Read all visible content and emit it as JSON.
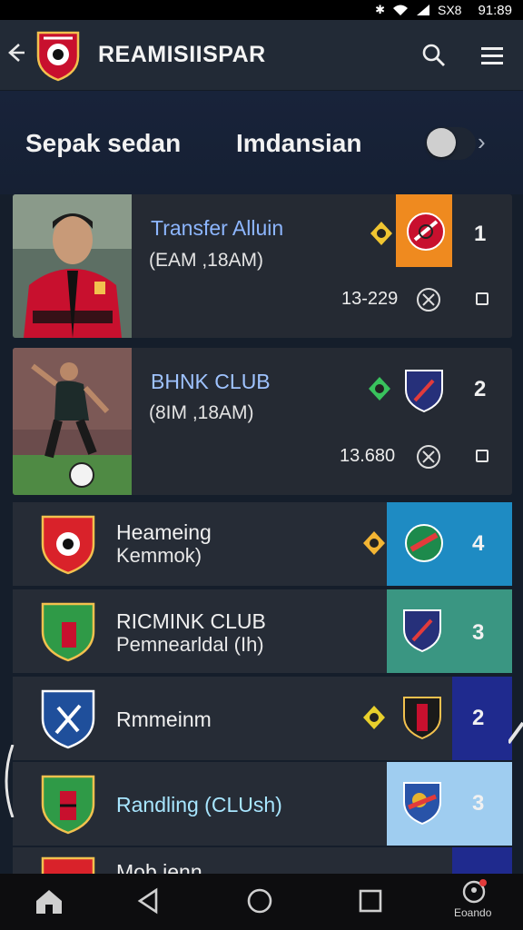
{
  "status": {
    "signal_text": "SX8",
    "time": "91:89"
  },
  "header": {
    "title": "REAMISIISPAR"
  },
  "filters": {
    "left_label": "Sepak sedan",
    "right_label": "Imdansian"
  },
  "cards": [
    {
      "title": "Transfer Alluin",
      "subtitle": "(EAM ,18AM)",
      "number": "13-229",
      "rank": "1",
      "title_color": "#8db6ff",
      "block_color": "#ef8a1f"
    },
    {
      "title": "BHNK CLUB",
      "subtitle": "(8IM ,18AM)",
      "number": "13.680",
      "rank": "2",
      "title_color": "#9fc3ff",
      "block_color": "#252a33"
    }
  ],
  "rows": [
    {
      "line1": "Heameing",
      "line2": "Kemmok)",
      "rank": "4",
      "block_color": "#1e8bc3",
      "name_color": "#f0f0f0"
    },
    {
      "line1": "RICMINK CLUB",
      "line2": "Pemnearldal (Ih)",
      "rank": "3",
      "block_color": "#3a9682",
      "name_color": "#f0f0f0"
    },
    {
      "line1": "Rmmeinm",
      "line2": "",
      "rank": "2",
      "block_color": "#1f2a8e",
      "name_color": "#f0f0f0"
    },
    {
      "line1": "Randling (CLUsh)",
      "line2": "",
      "rank": "3",
      "block_color": "#9fcdf0",
      "name_color": "#a8e6ff"
    },
    {
      "line1": "Mob ienn",
      "line2": "",
      "rank": "",
      "block_color": "#1f2a8e",
      "name_color": "#f0f0f0"
    }
  ],
  "nav": {
    "profile_label": "Eoando"
  },
  "icons": {
    "back": "arrow-left-icon",
    "search": "search-icon",
    "menu": "hamburger-menu-icon",
    "home": "home-icon",
    "nav_back": "triangle-back-icon",
    "nav_home": "circle-home-icon",
    "recents": "square-recents-icon",
    "profile": "profile-icon"
  }
}
